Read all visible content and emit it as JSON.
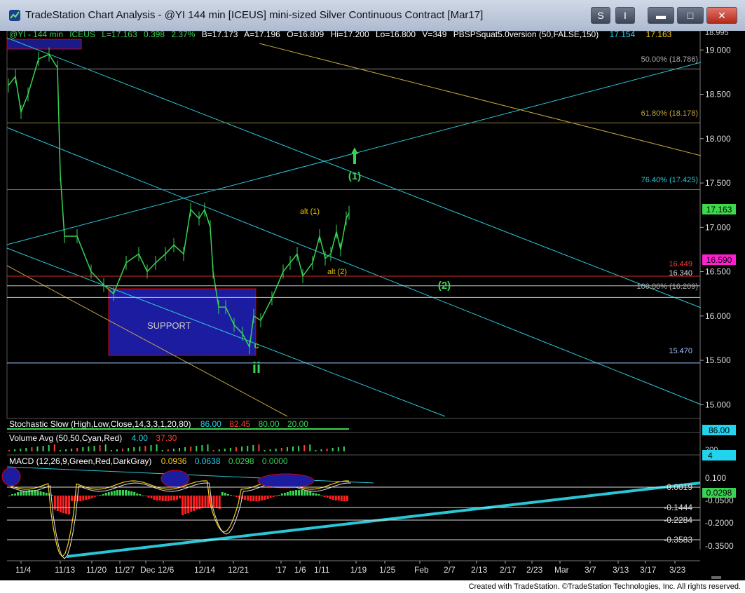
{
  "window": {
    "title": "TradeStation Chart Analysis - @YI 144 min [ICEUS] mini-sized Silver Continuous Contract [Mar17]",
    "buttons": {
      "s": "S",
      "i": "I",
      "minimize": "▬",
      "maximize": "□",
      "close": "✕"
    }
  },
  "header": {
    "symbol": "@YI - 144 min",
    "exchange": "ICEUS",
    "last": "L=17.163",
    "change": "0.398",
    "pct": "2.37%",
    "bid": "B=17.173",
    "ask": "A=17.196",
    "open": "O=16.809",
    "high": "Hi=17.200",
    "low": "Lo=16.800",
    "volume": "V=349",
    "study": "PBSPSquat5.0version (50,FALSE,150)",
    "v1": "17.154",
    "v2": "17.163"
  },
  "price_axis": {
    "ticks": [
      "19.000",
      "18.500",
      "18.000",
      "17.500",
      "17.000",
      "16.500",
      "16.000",
      "15.500",
      "15.000"
    ],
    "top_cut": "18.995",
    "last_price_tag": "17.163",
    "pink_tag": "16.590"
  },
  "fib_labels": {
    "f50": "50.00% (18.786)",
    "f618": "61.80% (18.178)",
    "f764": "76.40% (17.425)",
    "f100": "100.00% (16.209)"
  },
  "level_labels": {
    "l16449": "16.449",
    "l16340": "16.340",
    "l15470": "15.470"
  },
  "annotations": {
    "wave1": "(1)",
    "wave2": "(2)",
    "alt1": "alt (1)",
    "alt2": "alt (2)",
    "c": "c",
    "ii": "ii",
    "support": "SUPPORT"
  },
  "stochastic": {
    "label": "Stochastic Slow (High,Low,Close,14,3,3,1,20,80)",
    "v1": "86.00",
    "v2": "82.45",
    "v3": "80.00",
    "v4": "20.00",
    "tag": "86.00"
  },
  "volume": {
    "label": "Volume Avg (50,50,Cyan,Red)",
    "v1": "4.00",
    "v2": "37.30",
    "axis": "200",
    "tag": "4"
  },
  "macd": {
    "label": "MACD (12,26,9,Green,Red,DarkGray)",
    "v1": "0.0936",
    "v2": "0.0638",
    "v3": "0.0298",
    "v4": "0.0000",
    "ticks": [
      "0.100",
      "0.0019",
      "-0.0500",
      "-0.1444",
      "-0.2000",
      "-0.2284",
      "-0.3583",
      "-0.3500"
    ],
    "tag": "0.0298"
  },
  "time_axis": [
    "11/4",
    "11/13",
    "11/20",
    "11/27",
    "Dec",
    "12/6",
    "12/14",
    "12/21",
    "'17",
    "1/6",
    "1/11",
    "1/19",
    "1/25",
    "Feb",
    "2/7",
    "2/13",
    "2/17",
    "2/23",
    "Mar",
    "3/7",
    "3/13",
    "3/17",
    "3/23"
  ],
  "footer": "Created with TradeStation. ©TradeStation Technologies, Inc. All rights reserved.",
  "chart_data": {
    "type": "line",
    "title": "@YI 144 min [ICEUS] mini-sized Silver Continuous Contract [Mar17]",
    "ylim": [
      14.6,
      19.2
    ],
    "price_path": {
      "x": [
        "11/3",
        "11/4",
        "11/7",
        "11/9",
        "11/10",
        "11/11",
        "11/13",
        "11/14",
        "11/15",
        "11/17",
        "11/20",
        "11/22",
        "11/24",
        "11/27",
        "11/29",
        "Dec",
        "12/2",
        "12/5",
        "12/6",
        "12/8",
        "12/9",
        "12/12",
        "12/13",
        "12/14",
        "12/15",
        "12/16",
        "12/19",
        "12/20",
        "12/21",
        "12/22",
        "12/23",
        "12/26",
        "12/28",
        "12/29",
        "'17",
        "1/3",
        "1/5",
        "1/6",
        "1/9",
        "1/10",
        "1/11",
        "1/12",
        "1/13",
        "1/16",
        "1/17"
      ],
      "y": [
        18.6,
        18.7,
        18.3,
        18.5,
        18.9,
        18.95,
        18.8,
        17.6,
        16.9,
        16.9,
        16.5,
        16.35,
        16.25,
        16.6,
        16.7,
        16.5,
        16.6,
        16.7,
        16.8,
        16.7,
        17.2,
        17.1,
        17.2,
        17.0,
        16.5,
        16.1,
        16.1,
        15.9,
        15.8,
        15.65,
        16.0,
        15.95,
        16.2,
        16.5,
        16.6,
        16.7,
        16.45,
        16.6,
        16.9,
        16.65,
        16.7,
        16.95,
        16.75,
        17.1,
        17.163
      ]
    },
    "levels": [
      18.786,
      18.178,
      17.425,
      16.449,
      16.34,
      16.209,
      15.47
    ],
    "support_zone": [
      15.5,
      16.25
    ],
    "stochastic": {
      "slowk": 86.0,
      "slowd": 82.45,
      "overbought": 80.0,
      "oversold": 20.0
    },
    "volume_avg": [
      4.0,
      37.3
    ],
    "macd": {
      "macd": 0.0936,
      "signal": 0.0638,
      "hist": 0.0298,
      "zero": 0.0
    },
    "legend": "top-left",
    "grid": false
  }
}
